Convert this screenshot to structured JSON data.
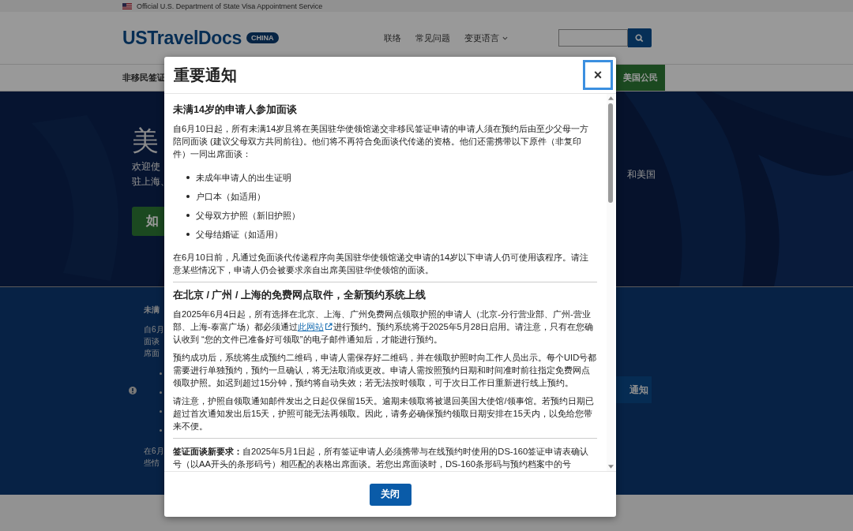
{
  "top_bar": {
    "text": "Official U.S. Department of State Visa Appointment Service"
  },
  "header": {
    "logo": "USTravelDocs",
    "badge": "CHINA",
    "nav": [
      {
        "label": "联络",
        "kind": "link"
      },
      {
        "label": "常见问题",
        "kind": "link"
      },
      {
        "label": "变更语言",
        "kind": "dropdown"
      }
    ]
  },
  "nav_bar": {
    "left": "非移民签证",
    "right": "美国公民"
  },
  "hero": {
    "heading": "美",
    "lines": [
      "欢迎使",
      "驻上海、"
    ],
    "right_line": "和美国",
    "button": "如"
  },
  "notice": {
    "heading": "未满",
    "lines": [
      "自6月",
      "面谈",
      "席面"
    ],
    "tail_lines": [
      "在6月",
      "些情"
    ],
    "button": "通知"
  },
  "modal": {
    "title": "重要通知",
    "close": "×",
    "button": "关闭",
    "blocks": [
      {
        "kind": "heading",
        "text": "未满14岁的申请人参加面谈"
      },
      {
        "kind": "paragraph",
        "text": "自6月10日起，所有未满14岁且将在美国驻华使领馆递交非移民签证申请的申请人须在预约后由至少父母一方陪同面谈 (建议父母双方共同前往)。他们将不再符合免面谈代传递的资格。他们还需携带以下原件（非复印件）一同出席面谈："
      },
      {
        "kind": "list",
        "items": [
          "未成年申请人的出生证明",
          "户口本（如适用）",
          "父母双方护照（新旧护照）",
          "父母结婚证（如适用）"
        ]
      },
      {
        "kind": "paragraph",
        "text": "在6月10日前，凡通过免面谈代传递程序向美国驻华使领馆递交申请的14岁以下申请人仍可使用该程序。请注意某些情况下，申请人仍会被要求亲自出席美国驻华使领馆的面谈。"
      },
      {
        "kind": "divider"
      },
      {
        "kind": "heading",
        "text": "在北京 / 广州 / 上海的免费网点取件，全新预约系统上线"
      },
      {
        "kind": "link_paragraph",
        "before": "自2025年6月4日起，所有选择在北京、上海、广州免费网点领取护照的申请人（北京-分行营业部、广州-营业部、上海-泰富广场）都必须通过",
        "link": "此网站",
        "after": "进行预约。预约系统将于2025年5月28日启用。请注意，只有在您确认收到 “您的文件已准备好可领取”的电子邮件通知后，才能进行预约。"
      },
      {
        "kind": "paragraph",
        "text": "预约成功后，系统将生成预约二维码，申请人需保存好二维码，并在领取护照时向工作人员出示。每个UID号都需要进行单独预约，预约一旦确认，将无法取消或更改。申请人需按照预约日期和时间准时前往指定免费网点领取护照。如迟到超过15分钟，预约将自动失效；若无法按时领取，可于次日工作日重新进行线上预约。"
      },
      {
        "kind": "paragraph",
        "text": "请注意，护照自领取通知邮件发出之日起仅保留15天。逾期未领取将被退回美国大使馆/领事馆。若预约日期已超过首次通知发出后15天，护照可能无法再领取。因此，请务必确保预约领取日期安排在15天内，以免给您带来不便。"
      },
      {
        "kind": "divider"
      },
      {
        "kind": "paragraph",
        "text": "**签证面谈新要求：**自2025年5月1日起，所有签证申请人必须携带与在线预约时使用的DS-160签证申请表确认号（以AA开头的条形码号）相匹配的表格出席面谈。若您出席面谈时，DS-160条形码与预约档案中的号"
      }
    ]
  }
}
